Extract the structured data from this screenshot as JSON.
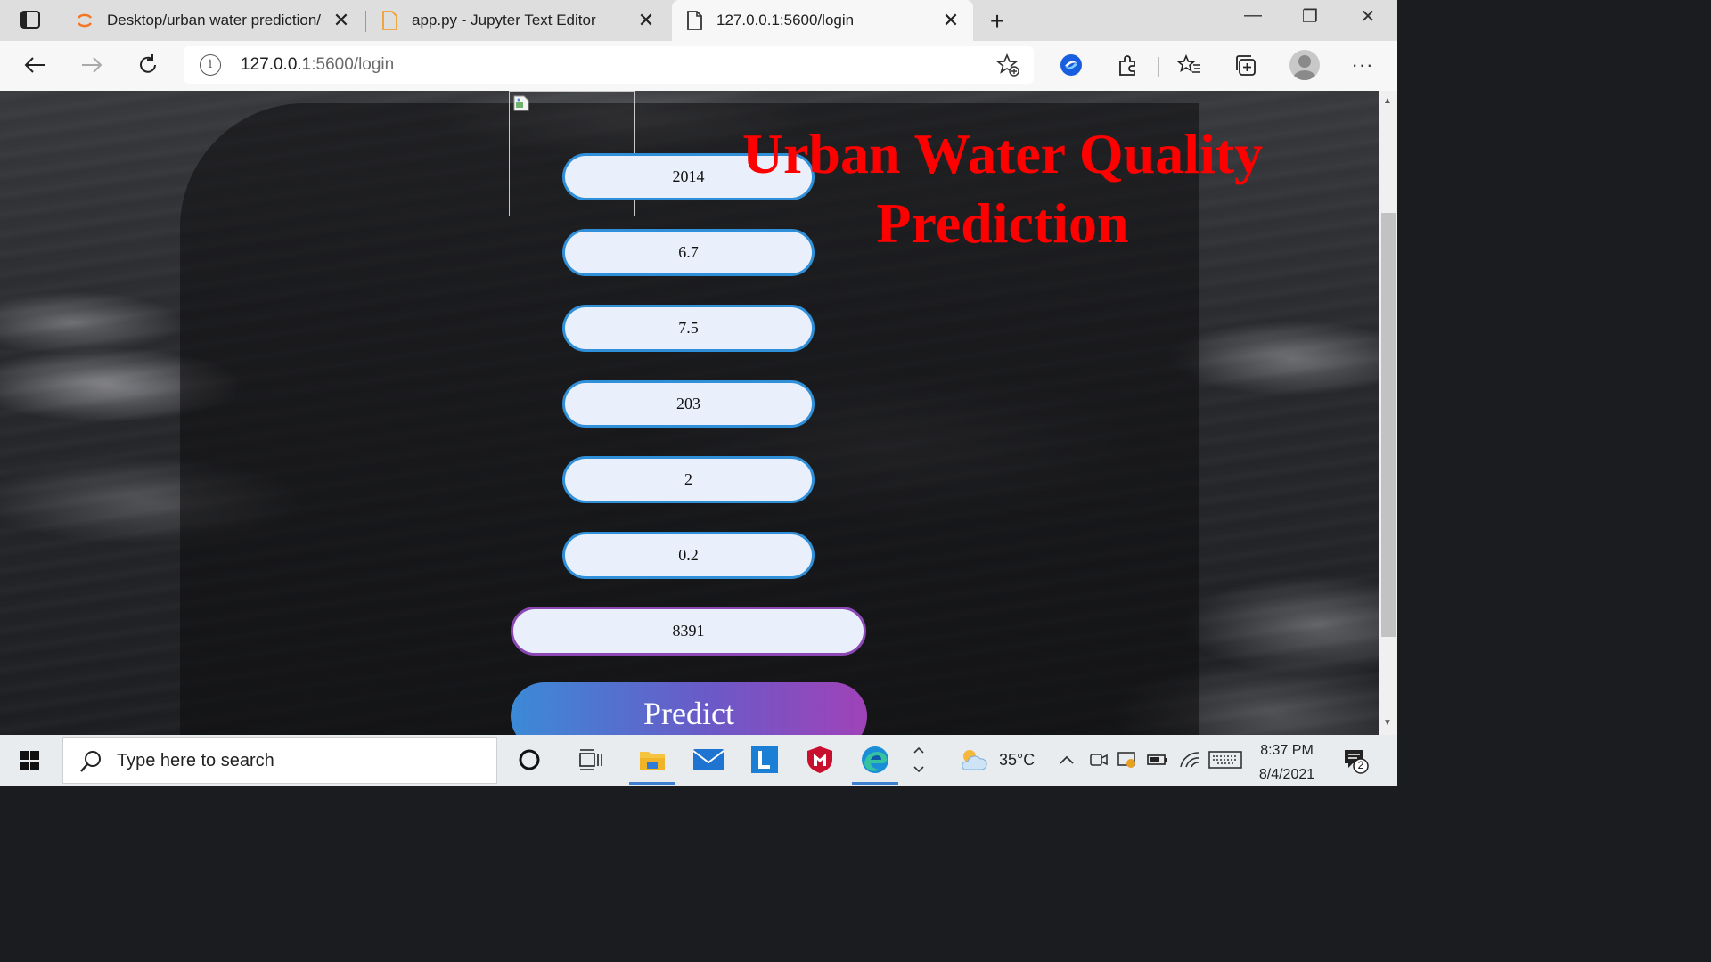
{
  "browser": {
    "tabs": [
      {
        "title": "Desktop/urban water prediction/",
        "icon": "jupyter-icon",
        "active": false
      },
      {
        "title": "app.py - Jupyter Text Editor",
        "icon": "file-icon",
        "active": false
      },
      {
        "title": "127.0.0.1:5600/login",
        "icon": "page-icon",
        "active": true
      }
    ],
    "url_host": "127.0.0.1",
    "url_path": ":5600/login"
  },
  "page": {
    "heading_line1": "Urban Water Quality",
    "heading_line2": "Prediction",
    "fields": [
      "2014",
      "6.7",
      "7.5",
      "203",
      "2",
      "0.2"
    ],
    "result": "8391",
    "predict_label": "Predict",
    "colors": {
      "heading": "#ff0000",
      "field_border": "#2f8fd8",
      "result_border": "#8b48b2"
    }
  },
  "taskbar": {
    "search_placeholder": "Type here to search",
    "weather": "35°C",
    "time": "8:37 PM",
    "date": "8/4/2021",
    "notification_count": "2"
  }
}
